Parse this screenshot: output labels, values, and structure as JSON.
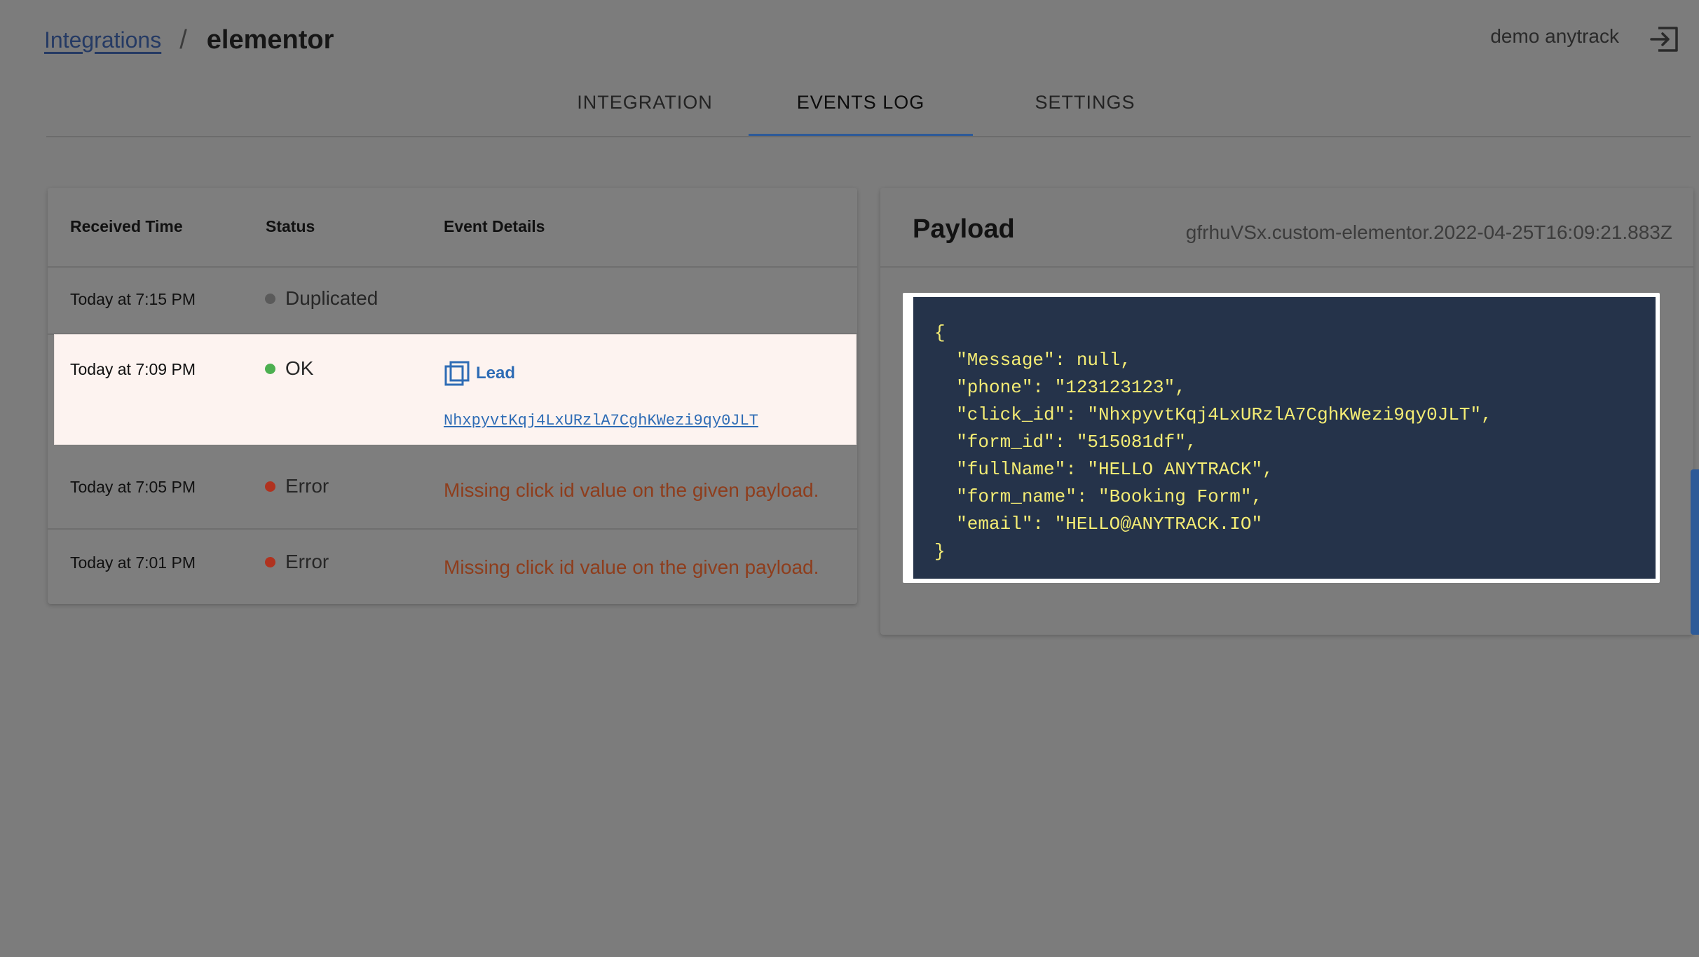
{
  "header": {
    "breadcrumb_link": "Integrations",
    "breadcrumb_separator": "/",
    "breadcrumb_current": "elementor",
    "user_name": "demo anytrack",
    "logout_icon": "logout-icon"
  },
  "tabs": [
    {
      "label": "INTEGRATION",
      "active": false
    },
    {
      "label": "EVENTS LOG",
      "active": true
    },
    {
      "label": "SETTINGS",
      "active": false
    }
  ],
  "events": {
    "columns": [
      "Received Time",
      "Status",
      "Event Details"
    ],
    "rows": [
      {
        "time": "Today at 7:15 PM",
        "status": "Duplicated",
        "status_color": "#5a5a5a",
        "details": ""
      },
      {
        "time": "Today at 7:09 PM",
        "status": "OK",
        "status_color": "#4caf50",
        "event_type": "Lead",
        "click_id": "NhxpyvtKqj4LxURzlA7CghKWezi9qy0JLT",
        "selected": true
      },
      {
        "time": "Today at 7:05 PM",
        "status": "Error",
        "status_color": "#b0321f",
        "details": "Missing click id value on the given payload."
      },
      {
        "time": "Today at 7:01 PM",
        "status": "Error",
        "status_color": "#b0321f",
        "details": "Missing click id value on the given payload."
      }
    ]
  },
  "payload": {
    "title": "Payload",
    "id": "gfrhuVSx.custom-elementor.2022-04-25T16:09:21.883Z",
    "json_text": "{\n  \"Message\": null,\n  \"phone\": \"123123123\",\n  \"click_id\": \"NhxpyvtKqj4LxURzlA7CghKWezi9qy0JLT\",\n  \"form_id\": \"515081df\",\n  \"fullName\": \"HELLO ANYTRACK\",\n  \"form_name\": \"Booking Form\",\n  \"email\": \"HELLO@ANYTRACK.IO\"\n}"
  },
  "colors": {
    "accent": "#2d5a98",
    "link": "#2f6cb5",
    "error_text": "#8e3d1c",
    "code_bg": "#25334a",
    "code_text": "#f4ec74"
  }
}
